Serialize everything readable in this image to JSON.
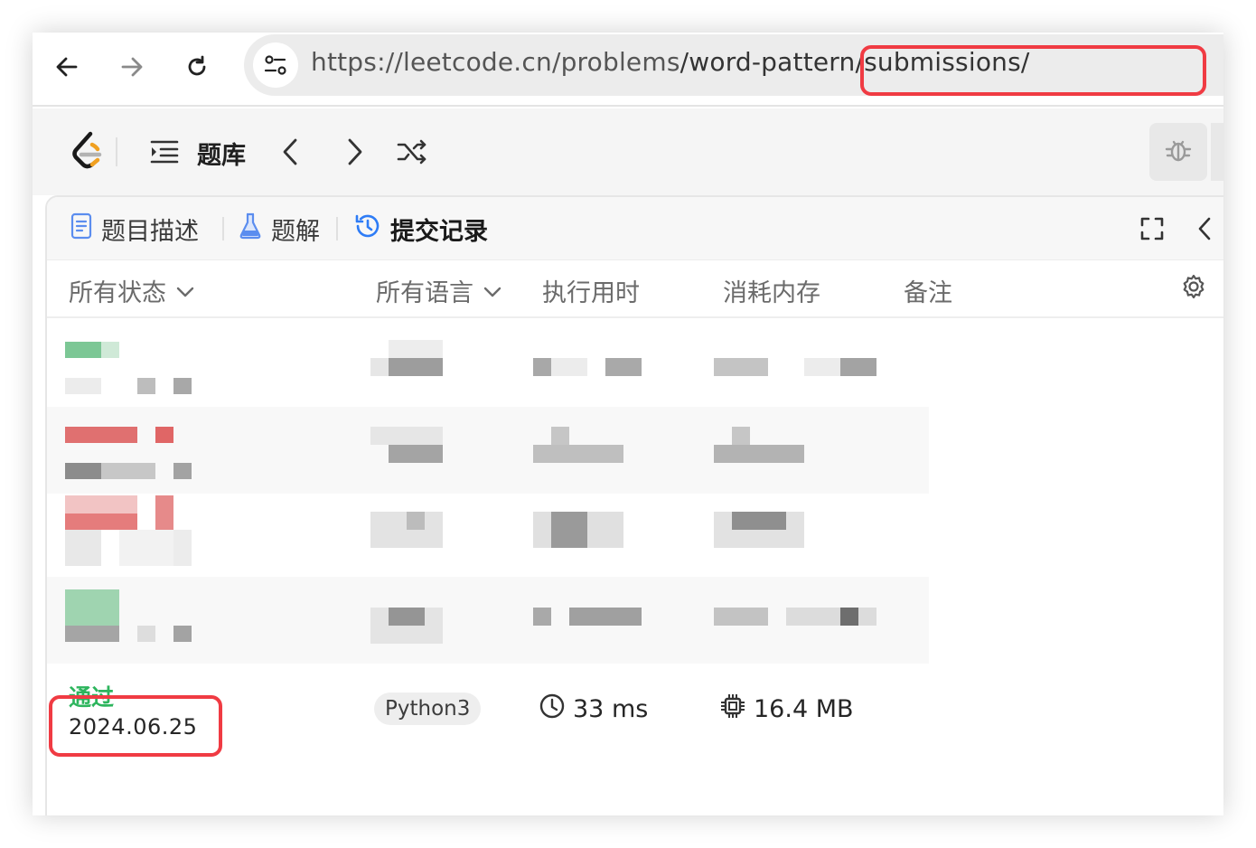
{
  "browser": {
    "url_prefix": "https://leetcode.cn/problems",
    "url_suffix": "/word-pattern/submissions/",
    "icons": [
      "back-arrow-icon",
      "forward-arrow-icon",
      "reload-icon",
      "site-settings-icon"
    ]
  },
  "toolbar": {
    "problem_bank_label": "题库",
    "icons": [
      "leetcode-logo",
      "list-icon",
      "chevron-left-icon",
      "chevron-right-icon",
      "shuffle-icon",
      "debug-bug-icon"
    ]
  },
  "tabs": [
    {
      "label": "题目描述",
      "icon": "document-icon",
      "active": false
    },
    {
      "label": "题解",
      "icon": "flask-icon",
      "active": false
    },
    {
      "label": "提交记录",
      "icon": "history-clock-icon",
      "active": true
    }
  ],
  "table": {
    "headers": {
      "status": "所有状态",
      "language": "所有语言",
      "runtime": "执行用时",
      "memory": "消耗内存",
      "notes": "备注"
    },
    "visible_submission": {
      "status": "通过",
      "date": "2024.06.25",
      "language": "Python3",
      "runtime": "33 ms",
      "memory": "16.4 MB"
    }
  },
  "colors": {
    "accepted": "#2db55d",
    "highlight": "#f03b43",
    "active_tab_icon": "#2e7cf6"
  }
}
